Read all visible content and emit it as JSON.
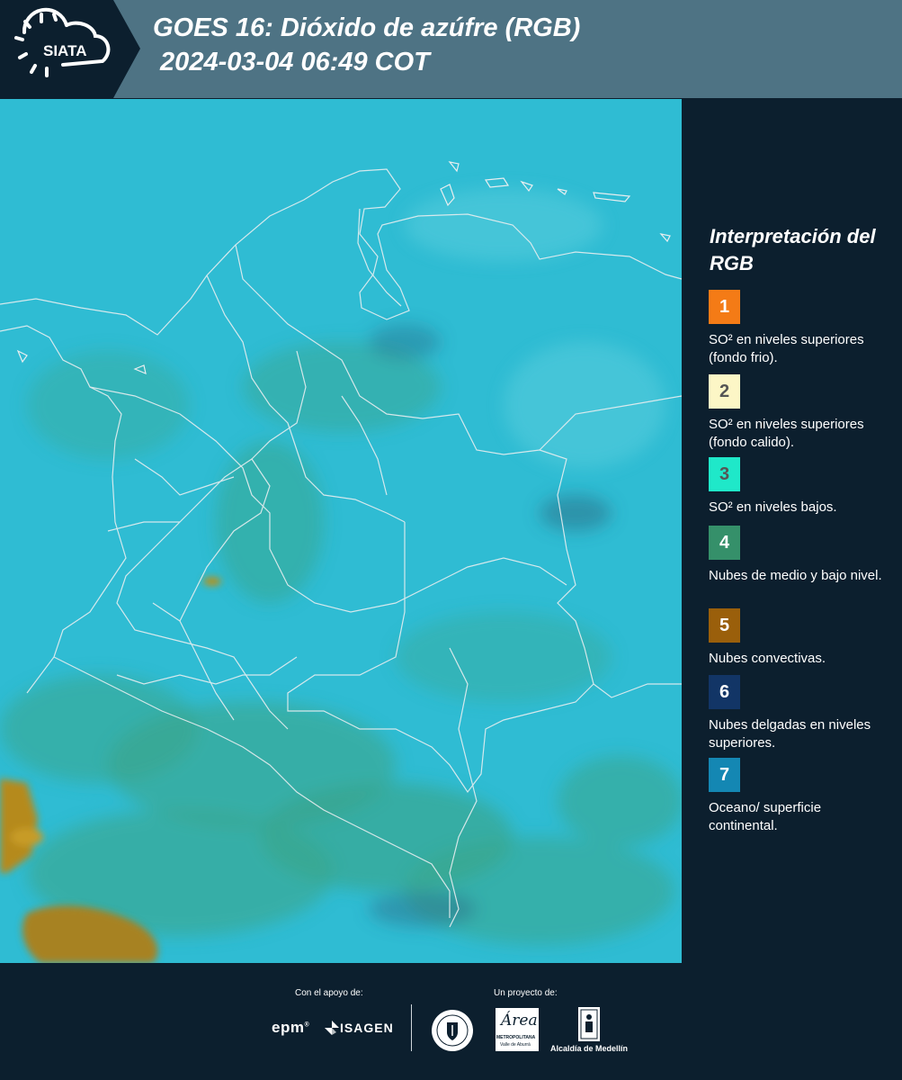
{
  "header": {
    "logo_text": "SIATA",
    "title": "GOES 16: Dióxido de azúfre (RGB)\n 2024-03-04 06:49 COT"
  },
  "legend": {
    "title": "Interpretación del RGB",
    "items": [
      {
        "number": "1",
        "color": "#f47b16",
        "text": "SO² en niveles superiores (fondo frio)."
      },
      {
        "number": "2",
        "color": "#fcf6c6",
        "text": "SO² en niveles superiores (fondo calido)."
      },
      {
        "number": "3",
        "color": "#1fe8c9",
        "text": "SO² en niveles bajos."
      },
      {
        "number": "4",
        "color": "#35906a",
        "text": "Nubes de medio y bajo nivel."
      },
      {
        "number": "5",
        "color": "#9a5f0b",
        "text": "Nubes convectivas."
      },
      {
        "number": "6",
        "color": "#123566",
        "text": "Nubes delgadas en niveles superiores."
      },
      {
        "number": "7",
        "color": "#1487b3",
        "text": "Oceano/ superficie continental."
      }
    ]
  },
  "footer": {
    "support_label": "Con el apoyo de:",
    "project_label": "Un proyecto de:",
    "epm_text": "epm",
    "isagen_text": "ISAGEN",
    "area_script": "Área",
    "area_line1": "METROPOLITANA",
    "area_line2": "Valle de Aburrá",
    "alcaldia_text": "Alcaldía de Medellín"
  },
  "colors": {
    "background": "#0c1f2e",
    "header": "#4e7384",
    "sea": "#2fbcd3",
    "land": "#3aa58a"
  }
}
